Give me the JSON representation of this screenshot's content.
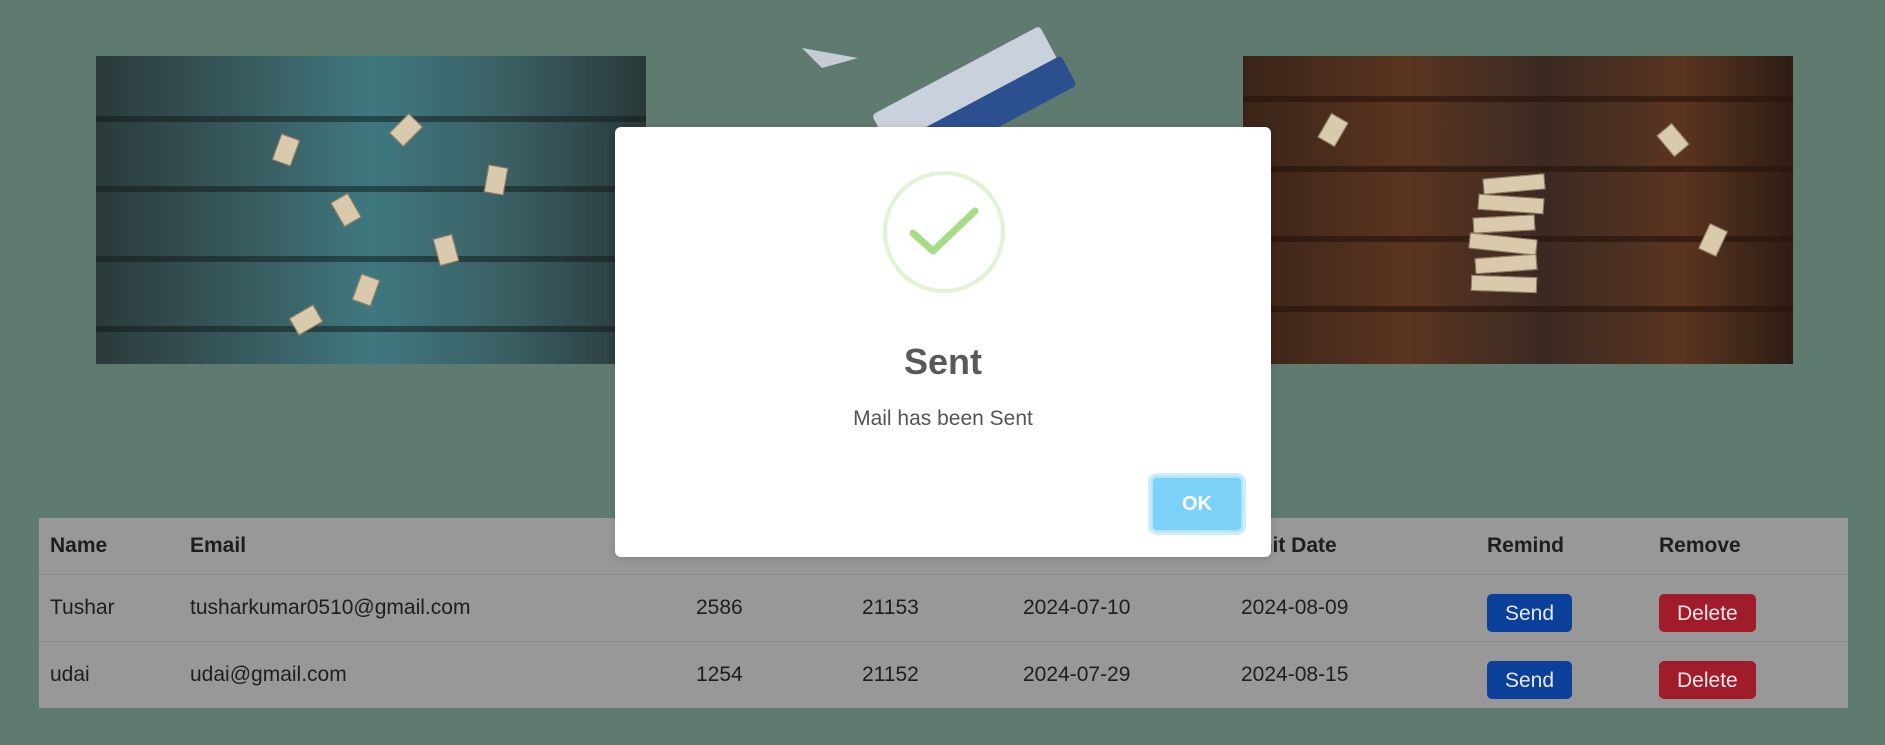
{
  "table": {
    "headers": [
      "Name",
      "Email",
      "",
      "",
      "",
      "bmit Date",
      "Remind",
      "Remove"
    ],
    "rows": [
      {
        "name": "Tushar",
        "email": "tusharkumar0510@gmail.com",
        "col3": "2586",
        "col4": "21153",
        "col5": "2024-07-10",
        "submit_date": "2024-08-09",
        "remind": "Send",
        "remove": "Delete"
      },
      {
        "name": "udai",
        "email": "udai@gmail.com",
        "col3": "1254",
        "col4": "21152",
        "col5": "2024-07-29",
        "submit_date": "2024-08-15",
        "remind": "Send",
        "remove": "Delete"
      }
    ]
  },
  "modal": {
    "title": "Sent",
    "message": "Mail has been Sent",
    "ok_label": "OK",
    "icon": "success-check-icon",
    "check_color": "#a5dc86"
  },
  "colors": {
    "background": "#5f7a6f",
    "send_button": "#0a3f9a",
    "delete_button": "#a01c2a",
    "ok_button": "#7cd1f9"
  }
}
